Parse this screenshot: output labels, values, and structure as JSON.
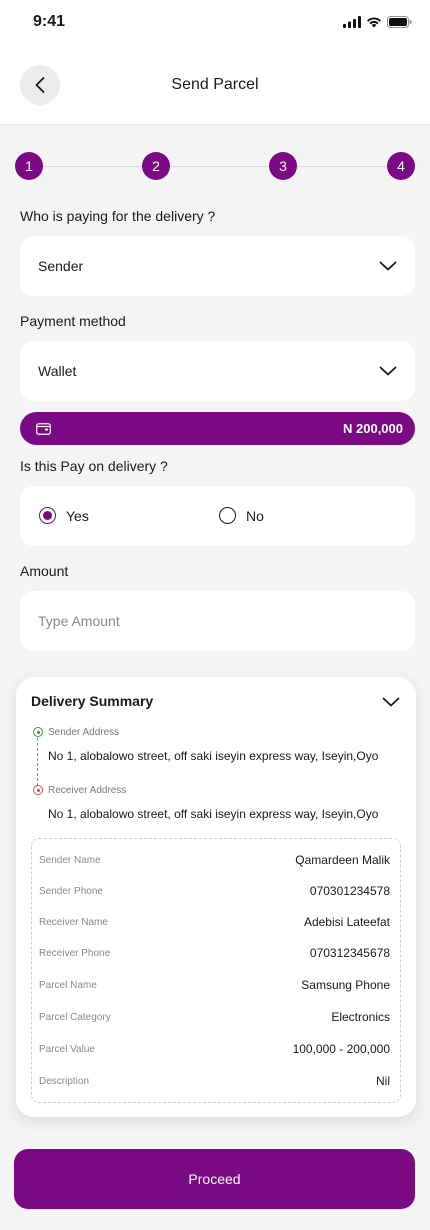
{
  "status_bar": {
    "time": "9:41"
  },
  "header": {
    "title": "Send Parcel"
  },
  "stepper": {
    "steps": [
      "1",
      "2",
      "3",
      "4"
    ]
  },
  "payer": {
    "label": "Who is paying for the delivery ?",
    "value": "Sender"
  },
  "payment_method": {
    "label": "Payment method",
    "value": "Wallet"
  },
  "wallet": {
    "balance": "N 200,000"
  },
  "pay_on_delivery": {
    "label": "Is this Pay on delivery ?",
    "options": [
      "Yes",
      "No"
    ],
    "selected": "Yes"
  },
  "amount": {
    "label": "Amount",
    "placeholder": "Type Amount"
  },
  "summary": {
    "title": "Delivery Summary",
    "sender_address_label": "Sender Address",
    "sender_address": "No 1, alobalowo street, off saki iseyin express way, Iseyin,Oyo",
    "receiver_address_label": "Receiver Address",
    "receiver_address": "No 1, alobalowo street, off saki iseyin express way, Iseyin,Oyo",
    "details": [
      {
        "key": "Sender Name",
        "value": "Qamardeen Malik"
      },
      {
        "key": "Sender Phone",
        "value": "070301234578"
      },
      {
        "key": "Receiver Name",
        "value": "Adebisi Lateefat"
      },
      {
        "key": "Receiver Phone",
        "value": "070312345678"
      },
      {
        "key": "Parcel Name",
        "value": "Samsung Phone"
      },
      {
        "key": "Parcel Category",
        "value": "Electronics"
      },
      {
        "key": "Parcel Value",
        "value": "100,000 - 200,000"
      },
      {
        "key": "Description",
        "value": "Nil"
      }
    ]
  },
  "proceed_label": "Proceed",
  "colors": {
    "brand": "#7a0a84",
    "sender_marker": "#2fa33a",
    "receiver_marker": "#e0454a"
  }
}
